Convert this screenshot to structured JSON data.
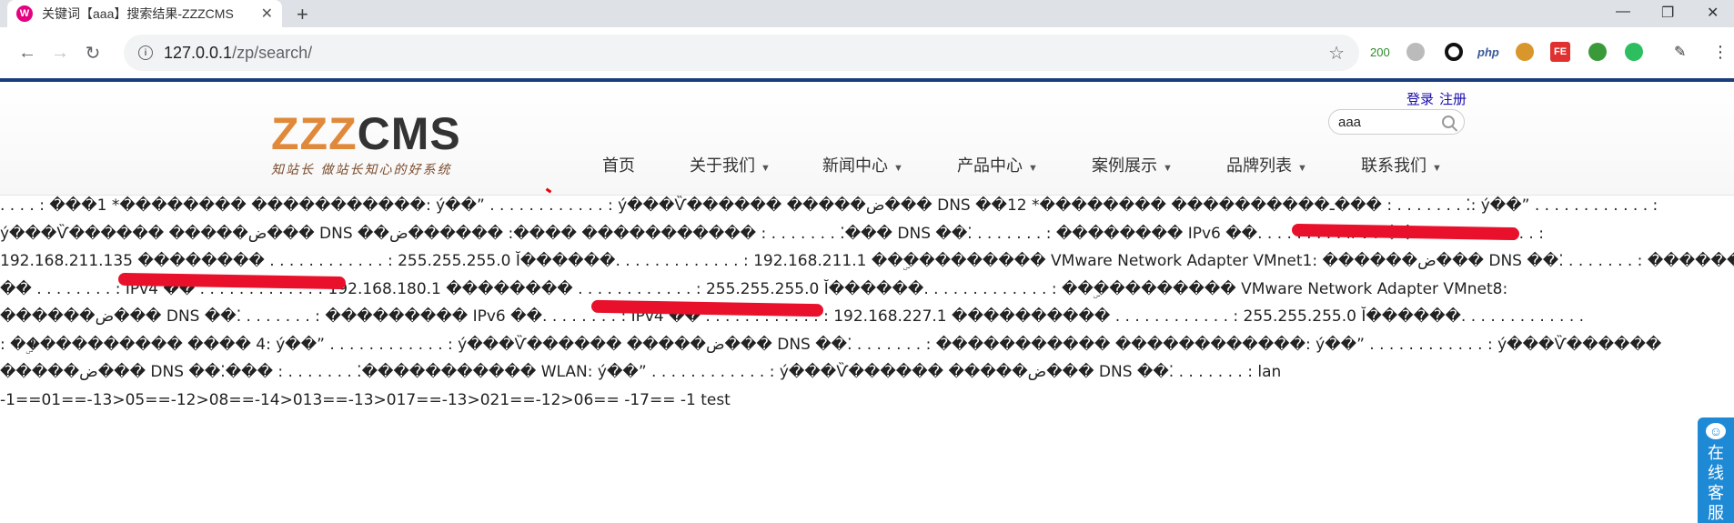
{
  "browser": {
    "tab_title": "关键词【aaa】搜索结果-ZZZCMS",
    "tab_favicon": "W",
    "url_host": "127.0.0.1",
    "url_path": "/zp/search/",
    "ext_badge": "200",
    "ext_php": "php",
    "ext_fe": "FE"
  },
  "header": {
    "login": "登录",
    "register": "注册",
    "search_value": "aaa",
    "logo_z": "ZZZ",
    "logo_cms": "CMS",
    "logo_slogan": "知站长  做站长知心的好系统"
  },
  "nav": [
    {
      "label": "首页",
      "has_dropdown": false
    },
    {
      "label": "关于我们",
      "has_dropdown": true
    },
    {
      "label": "新闻中心",
      "has_dropdown": true
    },
    {
      "label": "产品中心",
      "has_dropdown": true
    },
    {
      "label": "案例展示",
      "has_dropdown": true
    },
    {
      "label": "品牌列表",
      "has_dropdown": true
    },
    {
      "label": "联系我们",
      "has_dropdown": true
    }
  ],
  "content_lines": [
    ". . . . : ���1 *�������� �����������: ý��” . . . . . . . . . . . . : ý���Ѷ������ �����ض��� DNS ��12 *�������� ����������ـ��� : . . . . . . . ⁚: ý��” . . . . . . . . . . . . :",
    "ý���Ѷ������ �����ض��� DNS ��ض������ :���� ����������� : . . . . . . . ⁚��� DNS ��⁚ . . . . . . . : �������� IPv6 ��. . . . . . . . :                              IPv4 �� . . . . . . . . . . . . :",
    "192.168.211.135 �������� . . . . . . . . . . . . : 255.255.255.0 Ĭ������. . . . . . . . . . . . . : 192.168.211.1 ��ۣ��������� VMware Network Adapter VMnet1: ������ض��� DNS ��⁚ . . . . . . . : ���������� IPv6",
    "�� . . . . . . . . :                                IPv4 �� . . . . . . . . . . . . : 192.168.180.1 �������� . . . . . . . . . . . . : 255.255.255.0 Ĭ������. . . . . . . . . . . . . : ��ۣ��������� VMware Network Adapter VMnet8:",
    "������ض��� DNS ��⁚ . . . . . . . : ��������� IPv6 ��. . . . . . . . :                                 IPv4 �� . . . . . . . . . . . . : 192.168.227.1 ���������� . . . . . . . . . . . . : 255.255.255.0 Ĭ������. . . . . . . . . . . . .",
    ": ��ۣ��������� ���� 4: ý��” . . . . . . . . . . . . : ý���Ѷ������ �����ض��� DNS ��⁚ . . . . . . . : ����������� ������������: ý��” . . . . . . . . . . . . : ý���Ѷ������",
    "�����ض��� DNS ��⁚��� : . . . . . . . ⁚����������� WLAN: ý��” . . . . . . . . . . . . : ý���Ѷ������ �����ض��� DNS ��⁚ . . . . . . . : lan",
    "-1==01==-13>05==-12>08==-14>013==-13>017==-13>021==-12>06== -17== -1 test"
  ],
  "kefu": {
    "label": "在线客服"
  },
  "colors": {
    "accent": "#1a3d7c",
    "logo_orange": "#e0893a",
    "redaction": "#e8102a",
    "kefu_blue": "#1e8ad6"
  }
}
